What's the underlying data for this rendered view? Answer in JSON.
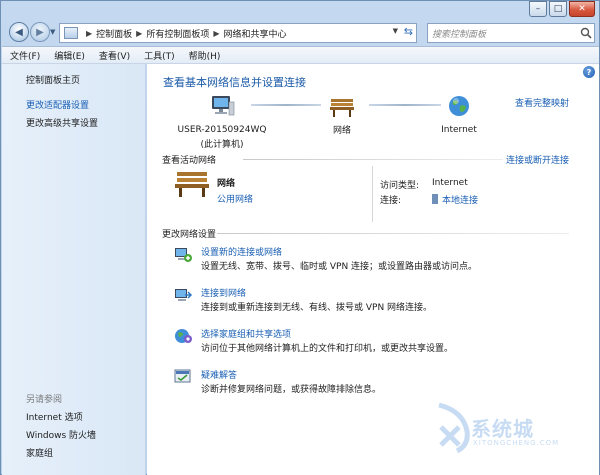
{
  "window": {
    "controls": {
      "minimize": "–",
      "maximize": "□",
      "close": "✕"
    }
  },
  "navbar": {
    "back_glyph": "◀",
    "forward_glyph": "▶",
    "breadcrumbs": [
      "控制面板",
      "所有控制面板项",
      "网络和共享中心"
    ],
    "search_placeholder": "搜索控制面板"
  },
  "menu": [
    "文件(F)",
    "编辑(E)",
    "查看(V)",
    "工具(T)",
    "帮助(H)"
  ],
  "sidebar": {
    "home": "控制面板主页",
    "items": [
      "更改适配器设置",
      "更改高级共享设置"
    ],
    "see_also_title": "另请参阅",
    "see_also": [
      "Internet 选项",
      "Windows 防火墙",
      "家庭组"
    ]
  },
  "main": {
    "title": "查看基本网络信息并设置连接",
    "full_map": "查看完整映射",
    "map": {
      "computer": "USER-20150924WQ",
      "computer_sub": "(此计算机)",
      "network": "网络",
      "internet": "Internet"
    },
    "active": {
      "title": "查看活动网络",
      "connect_link": "连接或断开连接",
      "network_name": "网络",
      "network_type": "公用网络",
      "access_label": "访问类型:",
      "access_value": "Internet",
      "conn_label": "连接:",
      "conn_value": "本地连接"
    },
    "change": {
      "title": "更改网络设置",
      "tasks": [
        {
          "title": "设置新的连接或网络",
          "desc": "设置无线、宽带、拨号、临时或 VPN 连接；或设置路由器或访问点。"
        },
        {
          "title": "连接到网络",
          "desc": "连接到或重新连接到无线、有线、拨号或 VPN 网络连接。"
        },
        {
          "title": "选择家庭组和共享选项",
          "desc": "访问位于其他网络计算机上的文件和打印机，或更改共享设置。"
        },
        {
          "title": "疑难解答",
          "desc": "诊断并修复网络问题，或获得故障排除信息。"
        }
      ]
    }
  },
  "watermark": {
    "text": "系统城",
    "sub": "XITONGCHENG.COM"
  }
}
